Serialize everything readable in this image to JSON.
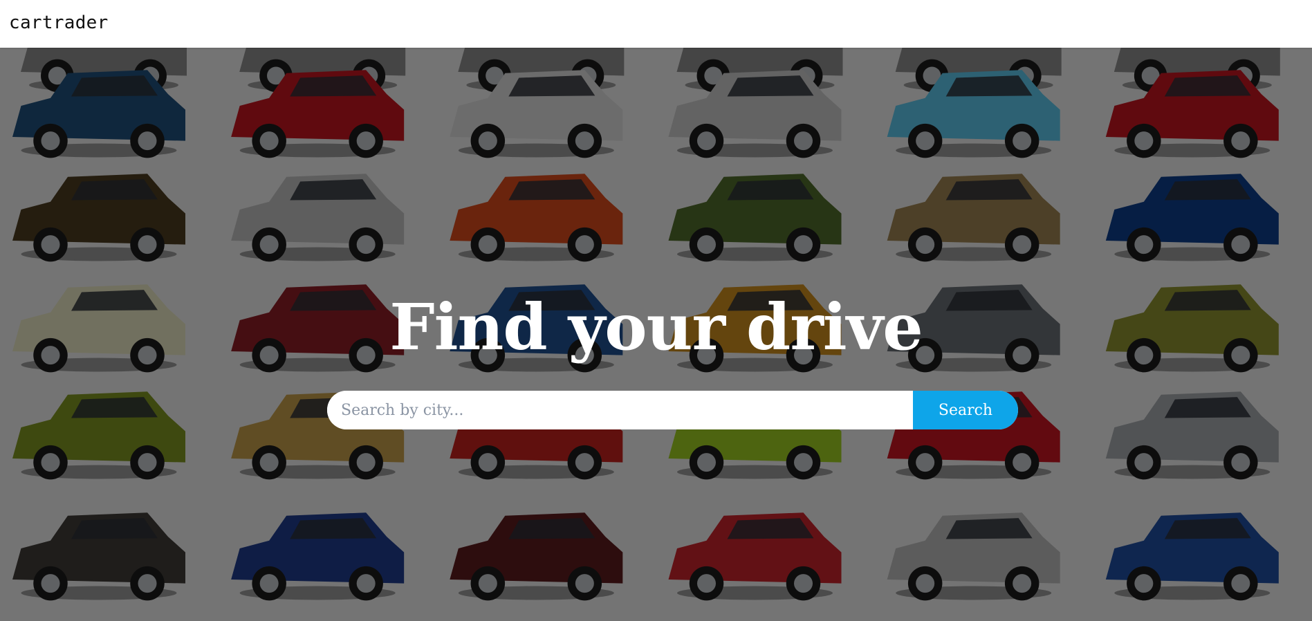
{
  "header": {
    "brand": "cartrader"
  },
  "hero": {
    "title": "Find your drive",
    "background_image_alt": "grid of car photos",
    "search": {
      "placeholder": "Search by city...",
      "value": "",
      "button_label": "Search"
    }
  },
  "colors": {
    "accent": "#0ea5e9",
    "overlay": "rgba(0,0,0,0.5)",
    "title_text": "#ffffff",
    "brand_text": "#111111"
  },
  "cars": [
    {
      "color": "#1f4f7a"
    },
    {
      "color": "#c0141e"
    },
    {
      "color": "#d9d9d9"
    },
    {
      "color": "#c7c7c7"
    },
    {
      "color": "#5bc3e6"
    },
    {
      "color": "#c0141e"
    },
    {
      "color": "#4a3b1f"
    },
    {
      "color": "#bdbdbd"
    },
    {
      "color": "#d4481b"
    },
    {
      "color": "#4f6a2a"
    },
    {
      "color": "#9b8050"
    },
    {
      "color": "#0c3c88"
    },
    {
      "color": "#e3e0bf"
    },
    {
      "color": "#8a1d25"
    },
    {
      "color": "#1f4e8f"
    },
    {
      "color": "#c98a1d"
    },
    {
      "color": "#676c72"
    },
    {
      "color": "#8a8f2f"
    },
    {
      "color": "#7c9321"
    },
    {
      "color": "#c19a48"
    },
    {
      "color": "#c1211c"
    },
    {
      "color": "#9ac921"
    },
    {
      "color": "#c41420"
    },
    {
      "color": "#a3a6ab"
    },
    {
      "color": "#3e3a36"
    },
    {
      "color": "#1e3a8a"
    },
    {
      "color": "#5a1a1d"
    },
    {
      "color": "#c5222a"
    },
    {
      "color": "#b8b8b8"
    },
    {
      "color": "#1f4c9e"
    }
  ]
}
